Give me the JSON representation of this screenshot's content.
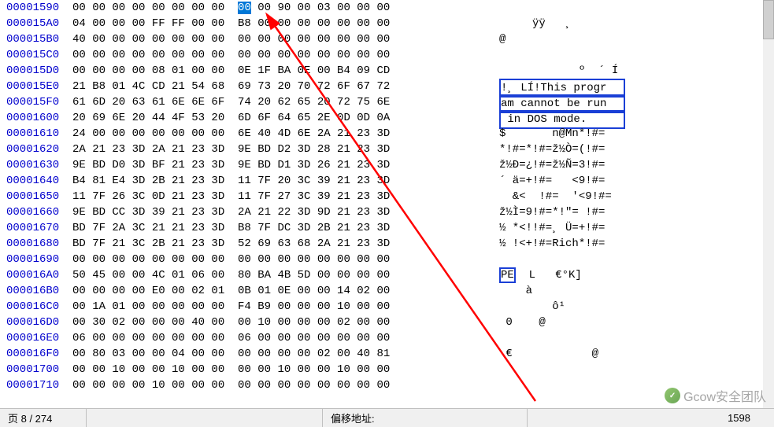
{
  "rows": [
    {
      "off": "00001590",
      "h1": "00 00 00 00 00 00 00 00",
      "h2a": "",
      "sel": "00",
      "h2b": " 00 90 00 03 00 00 00",
      "asc": ""
    },
    {
      "off": "000015A0",
      "h1": "04 00 00 00 FF FF 00 00",
      "h2a": "B8 00 00 00 00 00 00 00",
      "asc": "     ÿÿ   ¸"
    },
    {
      "off": "000015B0",
      "h1": "40 00 00 00 00 00 00 00",
      "h2a": "00 00 00 00 00 00 00 00",
      "asc": "@"
    },
    {
      "off": "000015C0",
      "h1": "00 00 00 00 00 00 00 00",
      "h2a": "00 00 00 00 00 00 00 00",
      "asc": ""
    },
    {
      "off": "000015D0",
      "h1": "00 00 00 00 08 01 00 00",
      "h2a": "0E 1F BA 0E 00 B4 09 CD",
      "asc": "            º  ´ Í"
    },
    {
      "off": "000015E0",
      "h1": "21 B8 01 4C CD 21 54 68",
      "h2a": "69 73 20 70 72 6F 67 72",
      "asc": "!¸ LÍ!This progr",
      "boxAsc": true
    },
    {
      "off": "000015F0",
      "h1": "61 6D 20 63 61 6E 6E 6F",
      "h2a": "74 20 62 65 20 72 75 6E",
      "asc": "am cannot be run",
      "boxAsc": true
    },
    {
      "off": "00001600",
      "h1": "20 69 6E 20 44 4F 53 20",
      "h2a": "6D 6F 64 65 2E 0D 0D 0A",
      "asc": " in DOS mode.   ",
      "boxAsc": true
    },
    {
      "off": "00001610",
      "h1": "24 00 00 00 00 00 00 00",
      "h2a": "6E 40 4D 6E 2A 21 23 3D",
      "asc": "$       n@Mn*!#="
    },
    {
      "off": "00001620",
      "h1": "2A 21 23 3D 2A 21 23 3D",
      "h2a": "9E BD D2 3D 28 21 23 3D",
      "asc": "*!#=*!#=ž½Ò=(!#="
    },
    {
      "off": "00001630",
      "h1": "9E BD D0 3D BF 21 23 3D",
      "h2a": "9E BD D1 3D 26 21 23 3D",
      "asc": "ž½Ð=¿!#=ž½Ñ=3!#="
    },
    {
      "off": "00001640",
      "h1": "B4 81 E4 3D 2B 21 23 3D",
      "h2a": "11 7F 20 3C 39 21 23 3D",
      "asc": "´ ä=+!#=   <9!#="
    },
    {
      "off": "00001650",
      "h1": "11 7F 26 3C 0D 21 23 3D",
      "h2a": "11 7F 27 3C 39 21 23 3D",
      "asc": "  &<  !#=  '<9!#="
    },
    {
      "off": "00001660",
      "h1": "9E BD CC 3D 39 21 23 3D",
      "h2a": "2A 21 22 3D 9D 21 23 3D",
      "asc": "ž½Ì=9!#=*!\"= !#="
    },
    {
      "off": "00001670",
      "h1": "BD 7F 2A 3C 21 21 23 3D",
      "h2a": "B8 7F DC 3D 2B 21 23 3D",
      "asc": "½ *<!!#=¸ Ü=+!#="
    },
    {
      "off": "00001680",
      "h1": "BD 7F 21 3C 2B 21 23 3D",
      "h2a": "52 69 63 68 2A 21 23 3D",
      "asc": "½ !<+!#=Rich*!#="
    },
    {
      "off": "00001690",
      "h1": "00 00 00 00 00 00 00 00",
      "h2a": "00 00 00 00 00 00 00 00",
      "asc": ""
    },
    {
      "off": "000016A0",
      "h1": "50 45 00 00 4C 01 06 00",
      "h2a": "80 BA 4B 5D 00 00 00 00",
      "asc": "",
      "ascPre": "PE",
      "ascPost": "  L   €°K]"
    },
    {
      "off": "000016B0",
      "h1": "00 00 00 00 E0 00 02 01",
      "h2a": "0B 01 0E 00 00 14 02 00",
      "asc": "    à"
    },
    {
      "off": "000016C0",
      "h1": "00 1A 01 00 00 00 00 00",
      "h2a": "F4 B9 00 00 00 10 00 00",
      "asc": "        ô¹"
    },
    {
      "off": "000016D0",
      "h1": "00 30 02 00 00 00 40 00",
      "h2a": "00 10 00 00 00 02 00 00",
      "asc": " 0    @"
    },
    {
      "off": "000016E0",
      "h1": "06 00 00 00 00 00 00 00",
      "h2a": "06 00 00 00 00 00 00 00",
      "asc": ""
    },
    {
      "off": "000016F0",
      "h1": "00 80 03 00 00 04 00 00",
      "h2a": "00 00 00 00 02 00 40 81",
      "asc": " €            @"
    },
    {
      "off": "00001700",
      "h1": "00 00 10 00 00 10 00 00",
      "h2a": "00 00 10 00 00 10 00 00",
      "asc": ""
    },
    {
      "off": "00001710",
      "h1": "00 00 00 00 10 00 00 00",
      "h2a": "00 00 00 00 00 00 00 00",
      "asc": ""
    }
  ],
  "status": {
    "page_label": "页 8 / 274",
    "offset_label": "偏移地址:",
    "offset_value": "1598"
  },
  "watermark": {
    "text": "Gcow安全团队"
  }
}
